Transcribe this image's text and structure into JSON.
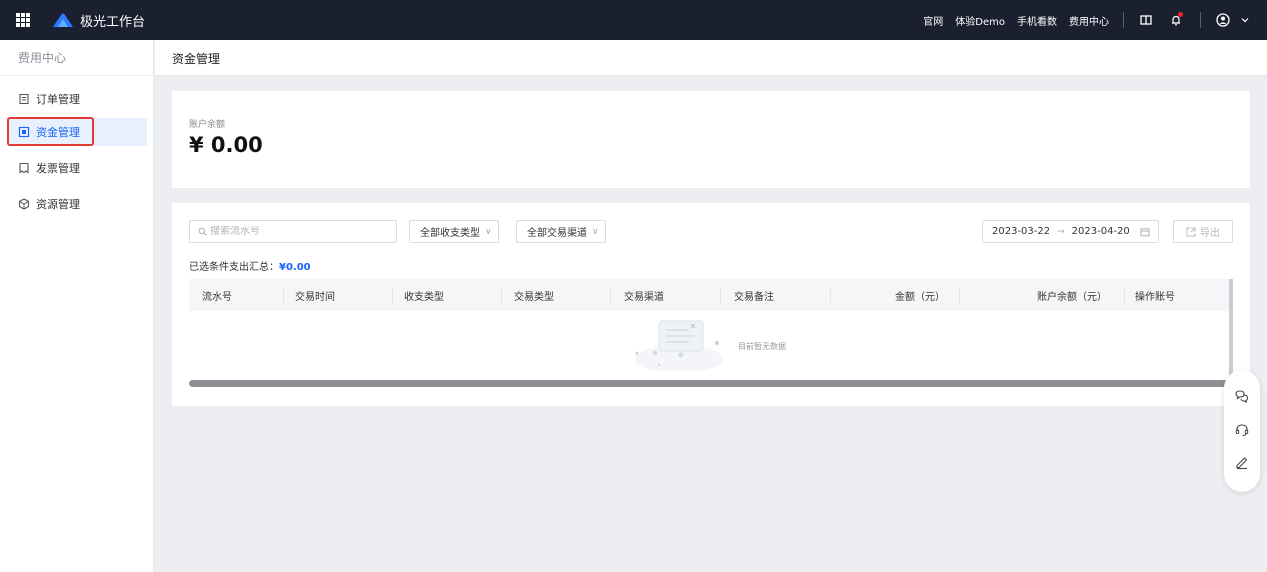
{
  "topbar": {
    "app_name": "极光工作台",
    "links": [
      "官网",
      "体验Demo",
      "手机看数",
      "费用中心"
    ]
  },
  "sidebar": {
    "title": "费用中心",
    "items": [
      {
        "label": "订单管理",
        "icon": "order-icon"
      },
      {
        "label": "资金管理",
        "icon": "fund-icon",
        "active": true
      },
      {
        "label": "发票管理",
        "icon": "invoice-icon"
      },
      {
        "label": "资源管理",
        "icon": "resource-icon"
      }
    ]
  },
  "page": {
    "title": "资金管理"
  },
  "balance": {
    "label": "账户余额",
    "value": "¥ 0.00"
  },
  "filters": {
    "search_placeholder": "搜索流水号",
    "type_select": "全部收支类型",
    "channel_select": "全部交易渠道",
    "date_start": "2023-03-22",
    "date_end": "2023-04-20",
    "export_label": "导出"
  },
  "summary": {
    "label": "已选条件支出汇总：",
    "value": "¥0.00"
  },
  "table": {
    "columns": [
      "流水号",
      "交易时间",
      "收支类型",
      "交易类型",
      "交易渠道",
      "交易备注",
      "金额（元）",
      "账户余额（元）",
      "操作账号"
    ],
    "rows": [],
    "empty_text": "目前暂无数据"
  },
  "colors": {
    "topbar_bg": "#1b2030",
    "accent": "#1664ff",
    "highlight_border": "#e53935"
  }
}
